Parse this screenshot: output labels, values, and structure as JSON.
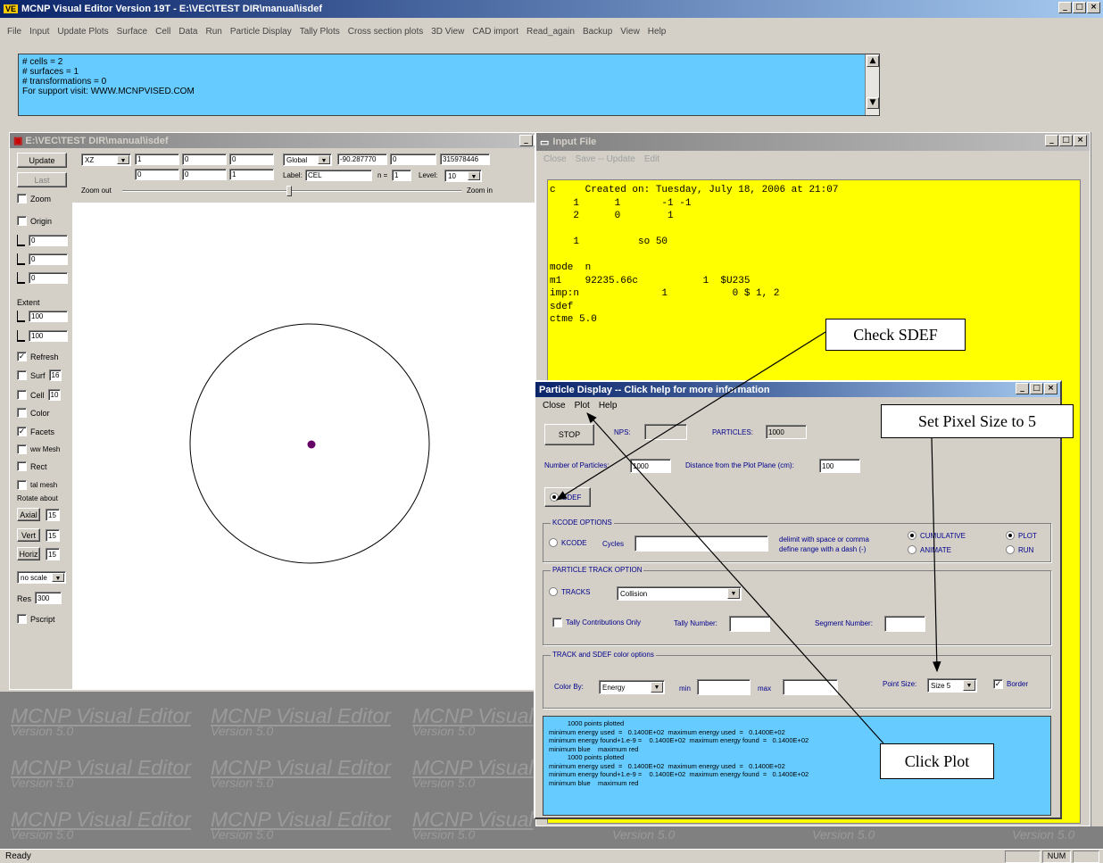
{
  "app": {
    "title": "MCNP Visual Editor Version 19T - E:\\VEC\\TEST DIR\\manual\\isdef",
    "logo": "VE",
    "menu": [
      "File",
      "Input",
      "Update Plots",
      "Surface",
      "Cell",
      "Data",
      "Run",
      "Particle Display",
      "Tally Plots",
      "Cross section plots",
      "3D View",
      "CAD import",
      "Read_again",
      "Backup",
      "View",
      "Help"
    ],
    "info_lines": [
      "# cells = 2",
      "# surfaces = 1",
      "# transformations = 0",
      "For support visit: WWW.MCNPVISED.COM"
    ]
  },
  "plot_window": {
    "title": "E:\\VEC\\TEST DIR\\manual\\isdef",
    "update_label": "Update",
    "last_label": "Last",
    "plane_value": "XZ",
    "origin_fields": [
      "1",
      "0",
      "0"
    ],
    "basis_fields": [
      "0",
      "0",
      "1"
    ],
    "coord_mode": "Global",
    "coord_x": "-90.287770",
    "coord_y": "0",
    "coord_z": "315978446",
    "label_text": "Label:",
    "label_value": "CEL",
    "ns_text": "n =",
    "ns_value": "1",
    "level_text": "Level:",
    "level_value": "10",
    "zoom_out_label": "Zoom out",
    "zoom_in_label": "Zoom in",
    "left_panel": {
      "zoom": "Zoom",
      "origin": "Origin",
      "origin_values": [
        "0",
        "0",
        "0"
      ],
      "extent": "Extent",
      "extent_values": [
        "100",
        "100"
      ],
      "refresh": "Refresh",
      "surf": "Surf",
      "surf_value": "16",
      "cell": "Cell",
      "cell_value": "10",
      "color": "Color",
      "facets": "Facets",
      "ww_mesh": "ww Mesh",
      "rect": "Rect",
      "talmesh": "tal mesh",
      "rotate_about": "Rotate about",
      "axial": "Axial",
      "axial_value": "15",
      "vert": "Vert",
      "vert_value": "15",
      "horiz": "Horiz",
      "horiz_value": "15",
      "scale_value": "no scale",
      "res": "Res",
      "res_value": "300",
      "pscript": "Pscript"
    }
  },
  "watermark": {
    "title": "MCNP Visual Editor",
    "title_partial": "MCNP Visual",
    "sub": "Version 5.0"
  },
  "input_window": {
    "title": "Input File",
    "menu": [
      "Close",
      "Save -- Update",
      "Edit"
    ],
    "lines": [
      "c     Created on: Tuesday, July 18, 2006 at 21:07",
      "    1      1       -1 -1",
      "    2      0        1",
      "",
      "    1          so 50",
      "",
      "mode  n",
      "m1    92235.66c           1  $U235",
      "imp:n              1           0 $ 1, 2",
      "sdef",
      "ctme 5.0"
    ]
  },
  "particle_display": {
    "title": "Particle Display -- Click help for more information",
    "menu": [
      "Close",
      "Plot",
      "Help"
    ],
    "stop_label": "STOP",
    "nps_label": "NPS:",
    "nps_value": "",
    "particles_label": "PARTICLES:",
    "particles_value": "1000",
    "num_particles_label": "Number of Particles:",
    "num_particles_value": "1000",
    "distance_label": "Distance from the Plot Plane (cm):",
    "distance_value": "100",
    "sdef_label": "SDEF",
    "kcode_group": "KCODE OPTIONS",
    "kcode_label": "KCODE",
    "cycles_label": "Cycles",
    "cycles_value": "",
    "delimit_line1": "delimit with space or comma",
    "delimit_line2": "define range with a dash (-)",
    "cumulative_label": "CUMULATIVE",
    "animate_label": "ANIMATE",
    "plot_label": "PLOT",
    "run_label": "RUN",
    "track_group": "PARTICLE TRACK OPTION",
    "tracks_label": "TRACKS",
    "tracks_value": "Collision",
    "tally_contrib_label": "Tally Contributions Only",
    "tally_number_label": "Tally Number:",
    "tally_number_value": "",
    "segment_number_label": "Segment Number:",
    "segment_number_value": "",
    "color_group": "TRACK and SDEF color options",
    "color_by_label": "Color By:",
    "color_by_value": "Energy",
    "min_label": "min",
    "min_value": "",
    "max_label": "max",
    "max_value": "",
    "point_size_label": "Point Size:",
    "point_size_value": "Size 5",
    "border_label": "Border",
    "log_lines": [
      "          1000 points plotted",
      "minimum energy used  =   0.1400E+02  maximum energy used  =   0.1400E+02",
      "minimum energy found+1.e-9 =    0.1400E+02  maximum energy found  =   0.1400E+02",
      "minimum blue    maximum red",
      "          1000 points plotted",
      "minimum energy used  =   0.1400E+02  maximum energy used  =   0.1400E+02",
      "minimum energy found+1.e-9 =    0.1400E+02  maximum energy found  =   0.1400E+02",
      "minimum blue    maximum red"
    ]
  },
  "callouts": {
    "check_sdef": "Check SDEF",
    "pixel_size": "Set Pixel Size to 5",
    "click_plot": "Click Plot"
  },
  "status": {
    "left": "Ready",
    "num": "NUM"
  },
  "colors": {
    "info_bg": "#66ccff",
    "input_bg": "#ffff00",
    "accent": "#0a246a",
    "particle_dot": "#660066"
  }
}
